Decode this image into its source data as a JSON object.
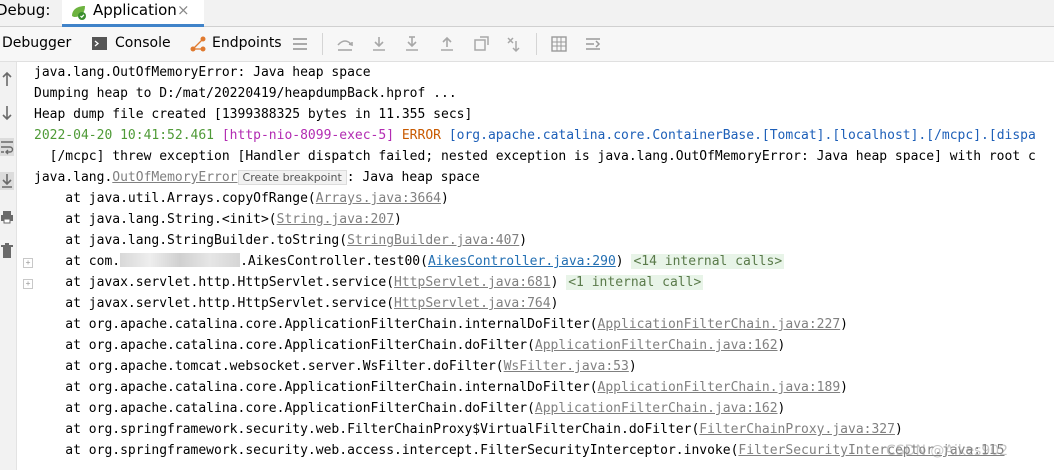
{
  "window": {
    "debug_label": "Debug:",
    "app_tab_title": "Application",
    "close_glyph": "×"
  },
  "toolbar": {
    "debugger": "Debugger",
    "console": "Console",
    "endpoints": "Endpoints"
  },
  "console": {
    "l1": "java.lang.OutOfMemoryError: Java heap space",
    "l2": "Dumping heap to D:/mat/20220419/heapdumpBack.hprof ...",
    "l3": "Heap dump file created [1399388325 bytes in 11.355 secs]",
    "l4_time": "2022-04-20 10:41:52.461",
    "l4_thread": "[http-nio-8099-exec-5]",
    "l4_level": "ERROR",
    "l4_logger": "[org.apache.catalina.core.ContainerBase.[Tomcat].[localhost].[/mcpc].[dispa",
    "l5": "  [/mcpc] threw exception [Handler dispatch failed; nested exception is java.lang.OutOfMemoryError: Java heap space] with root c",
    "l6_pre": "java.lang.",
    "l6_link": "OutOfMemoryError",
    "l6_tooltip": "Create breakpoint",
    "l6_post": ": Java heap space",
    "f1_pre": "    at java.util.Arrays.copyOfRange(",
    "f1_link": "Arrays.java:3664",
    "f2_pre": "    at java.lang.String.<init>(",
    "f2_link": "String.java:207",
    "f3_pre": "    at java.lang.StringBuilder.toString(",
    "f3_link": "StringBuilder.java:407",
    "f4_pre": "    at com.",
    "f4_mid": ".AikesController.test00(",
    "f4_link": "AikesController.java:290",
    "f4_tag": "<14 internal calls>",
    "f5_pre": "    at javax.servlet.http.HttpServlet.service(",
    "f5_link": "HttpServlet.java:681",
    "f5_tag": "<1 internal call>",
    "f6_pre": "    at javax.servlet.http.HttpServlet.service(",
    "f6_link": "HttpServlet.java:764",
    "f7_pre": "    at org.apache.catalina.core.ApplicationFilterChain.internalDoFilter(",
    "f7_link": "ApplicationFilterChain.java:227",
    "f8_pre": "    at org.apache.catalina.core.ApplicationFilterChain.doFilter(",
    "f8_link": "ApplicationFilterChain.java:162",
    "f9_pre": "    at org.apache.tomcat.websocket.server.WsFilter.doFilter(",
    "f9_link": "WsFilter.java:53",
    "f10_pre": "    at org.apache.catalina.core.ApplicationFilterChain.internalDoFilter(",
    "f10_link": "ApplicationFilterChain.java:189",
    "f11_pre": "    at org.apache.catalina.core.ApplicationFilterChain.doFilter(",
    "f11_link": "ApplicationFilterChain.java:162",
    "f12_pre": "    at org.springframework.security.web.FilterChainProxy$VirtualFilterChain.doFilter(",
    "f12_link": "FilterChainProxy.java:327",
    "f13_pre": "    at org.springframework.security.web.access.intercept.FilterSecurityInterceptor.invoke(",
    "f13_link": "FilterSecurityInterceptor.java:115",
    "close_paren": ")"
  },
  "watermark": "CSDN @Aikes902",
  "colors": {
    "tab_accent": "#4083c9",
    "timestamp": "#4f9a37",
    "thread": "#b22cb2",
    "error": "#c85a00",
    "logger": "#1d5fb8",
    "link": "#808080",
    "link_active": "#2470b3"
  },
  "icons": {
    "app": "spring-boot-app-icon",
    "console": "console-icon",
    "endpoints": "endpoints-icon",
    "menu": "hamburger-icon",
    "step_over": "step-over-icon",
    "step_into": "step-into-icon",
    "force_step_into": "force-step-into-icon",
    "step_out": "step-out-icon",
    "drop_frame": "drop-frame-icon",
    "run_to_cursor": "run-to-cursor-icon",
    "evaluate": "evaluate-expression-icon",
    "trace": "trace-icon"
  }
}
